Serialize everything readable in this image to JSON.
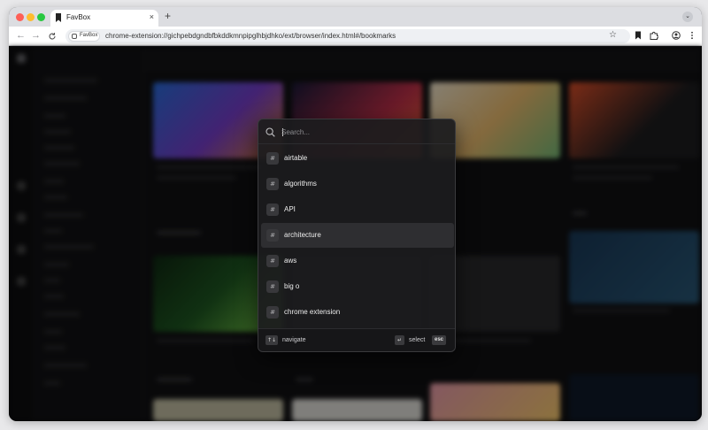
{
  "browser": {
    "tab_title": "FavBox",
    "tab_close": "×",
    "new_tab": "+",
    "tab_menu": "⌄",
    "site_chip_label": "FavBox",
    "url": "chrome-extension://gichpebdgndbfbkddkmnpipglhbjdhko/ext/browser/index.html#/bookmarks"
  },
  "palette": {
    "search_placeholder": "Search...",
    "items": [
      {
        "label": "airtable",
        "glyph": "#",
        "active": false
      },
      {
        "label": "algorithms",
        "glyph": "#",
        "active": false
      },
      {
        "label": "API",
        "glyph": "#",
        "active": false
      },
      {
        "label": "architecture",
        "glyph": "#",
        "active": true
      },
      {
        "label": "aws",
        "glyph": "#",
        "active": false
      },
      {
        "label": "big o",
        "glyph": "#",
        "active": false
      },
      {
        "label": "chrome extension",
        "glyph": "#",
        "active": false
      }
    ],
    "footer": {
      "navigate_key": "↑↓",
      "navigate_label": "navigate",
      "select_key": "↵",
      "select_label": "select",
      "esc_key": "esc"
    }
  }
}
